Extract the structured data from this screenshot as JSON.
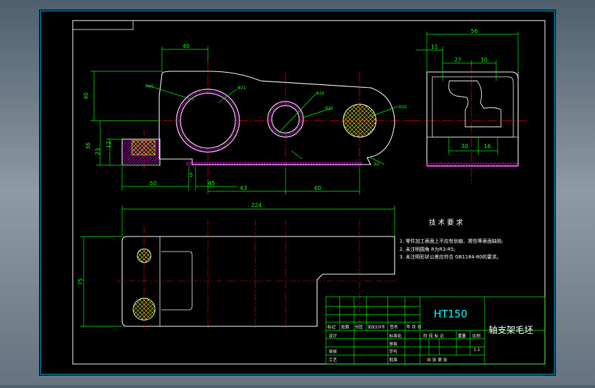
{
  "colors": {
    "background": "#000000",
    "outline": "#ffffff",
    "dimension": "#00ff00",
    "center_line": "#ff0000",
    "hatch_magenta": "#ff00ff",
    "hatch_yellow": "#ffff00",
    "text": "#ffffff",
    "material": "#00ffff",
    "title_block_line": "#00ff00"
  },
  "front_view": {
    "dims": {
      "top_40": "40",
      "height_40": "40",
      "height_36": "36",
      "height_23": "23",
      "height_12": "12",
      "bottom_50": "50",
      "bottom_5": "5",
      "bottom_45": "45",
      "bottom_63": "63",
      "bottom_60": "60",
      "r_big": "R40",
      "r_mid": "R25",
      "r_small": "R20",
      "phi_left": "Φ21",
      "phi_mid": "Φ24",
      "phi_right": "R5"
    }
  },
  "side_view": {
    "dims": {
      "top_56": "56",
      "top_11": "11",
      "top_27": "27",
      "top_30": "30",
      "bottom_30": "30",
      "bottom_16": "16"
    }
  },
  "top_view": {
    "dims": {
      "length_224": "224",
      "width_75": "75"
    }
  },
  "notes": {
    "heading": "技 术 要 求",
    "line1": "1. 零件加工表面上不应有划痕、擦伤等表面缺陷;",
    "line2": "2. 未注明圆角 R为R3-R5;",
    "line3": "3. 未注明形状公差应符合 GB1184-80的要求。"
  },
  "title_block": {
    "material": "HT150",
    "part_name": "轴支架毛坯",
    "scale": "1:1",
    "header_row": [
      "标记",
      "处数",
      "分区",
      "更改文件号",
      "签名",
      "年 月 日"
    ],
    "row_design": "设计",
    "row_std": "标准化",
    "row_check": "审核",
    "row_process": "工艺",
    "row_approve": "批准",
    "row_id": "学号",
    "col_stage": "阶 段 标 记",
    "col_weight": "重量",
    "col_scale": "比例",
    "sheet_text": "共  张  第  张"
  }
}
